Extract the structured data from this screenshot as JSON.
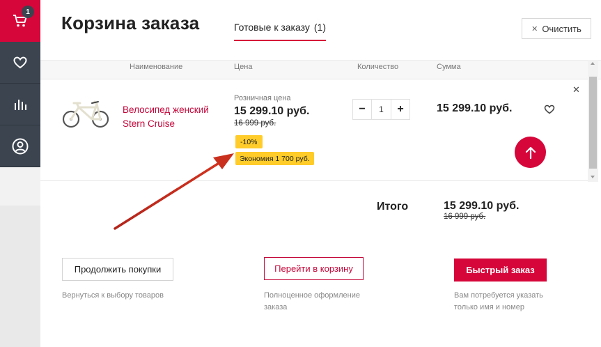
{
  "sidebar": {
    "cart_badge": "1",
    "items": [
      {
        "icon": "cart-icon"
      },
      {
        "icon": "heart-icon"
      },
      {
        "icon": "stats-icon"
      },
      {
        "icon": "user-icon"
      }
    ]
  },
  "header": {
    "title": "Корзина заказа",
    "tab_label": "Готовые к заказу",
    "tab_count": "(1)",
    "clear_label": "Очистить"
  },
  "table": {
    "columns": [
      "Наименование",
      "Цена",
      "Количество",
      "Сумма"
    ]
  },
  "item": {
    "name": "Велосипед женский Stern Cruise",
    "price_label": "Розничная цена",
    "price_now": "15 299.10 руб.",
    "price_old": "16 999 руб.",
    "discount": "-10%",
    "savings": "Экономия 1 700 руб.",
    "quantity": "1",
    "sum": "15 299.10 руб."
  },
  "total": {
    "label": "Итого",
    "now": "15 299.10 руб.",
    "old": "16 999 руб."
  },
  "actions": {
    "continue_label": "Продолжить покупки",
    "continue_hint": "Вернуться к выбору товаров",
    "cart_label": "Перейти в корзину",
    "cart_hint": "Полноценное оформление заказа",
    "quick_label": "Быстрый заказ",
    "quick_hint": "Вам потребуется указать только имя и номер"
  },
  "colors": {
    "accent": "#d6063a",
    "sidebar": "#3b444f",
    "badge_yellow": "#ffcc29",
    "annotation_arrow": "#c0261c"
  }
}
